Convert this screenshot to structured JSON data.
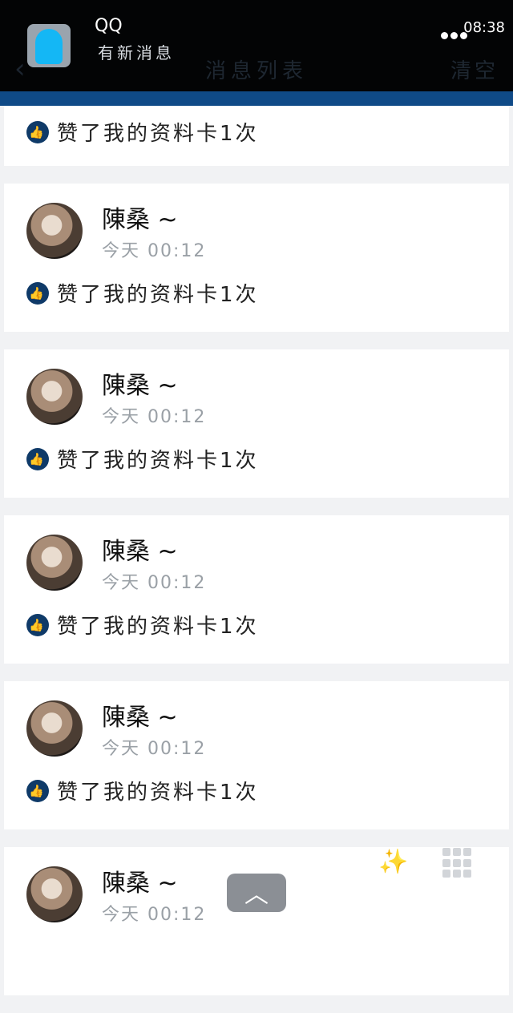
{
  "header": {
    "nav_title": "消息列表",
    "nav_clear": "清空",
    "back_icon": "‹",
    "notification": {
      "app": "QQ",
      "text": "有新消息"
    },
    "status_time": "08:38"
  },
  "partial_like_text": "赞了我的资料卡1次",
  "entries": [
    {
      "name": "陳桑 ~",
      "time": "今天 00:12",
      "action": "赞了我的资料卡1次"
    },
    {
      "name": "陳桑 ~",
      "time": "今天 00:12",
      "action": "赞了我的资料卡1次"
    },
    {
      "name": "陳桑 ~",
      "time": "今天 00:12",
      "action": "赞了我的资料卡1次"
    },
    {
      "name": "陳桑 ~",
      "time": "今天 00:12",
      "action": "赞了我的资料卡1次"
    },
    {
      "name": "陳桑 ~",
      "time": "今天 00:12",
      "action": ""
    }
  ],
  "controls": {
    "scroll_top_glyph": "︿"
  },
  "colors": {
    "header_bg": "#030405",
    "accent_blue": "#0f4a87",
    "like_icon": "#0f3a68"
  }
}
